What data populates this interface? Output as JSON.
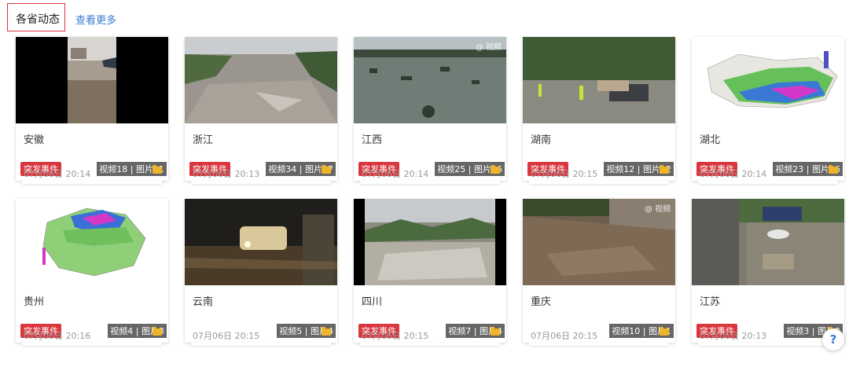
{
  "header": {
    "title": "各省动态",
    "more_link": "查看更多"
  },
  "help_label": "?",
  "cards": [
    {
      "name": "安徽",
      "counts": "视频18 | 图片11",
      "tag": "突发事件",
      "time": "07月06日 20:14",
      "watermark": ""
    },
    {
      "name": "浙江",
      "counts": "视频34 | 图片37",
      "tag": "突发事件",
      "time": "07月06日 20:13",
      "watermark": ""
    },
    {
      "name": "江西",
      "counts": "视频25 | 图片96",
      "tag": "突发事件",
      "time": "07月06日 20:14",
      "watermark": "@ 视频"
    },
    {
      "name": "湖南",
      "counts": "视频12 | 图片12",
      "tag": "突发事件",
      "time": "07月06日 20:15",
      "watermark": ""
    },
    {
      "name": "湖北",
      "counts": "视频23 | 图片16",
      "tag": "突发事件",
      "time": "07月06日 20:14",
      "watermark": ""
    },
    {
      "name": "贵州",
      "counts": "视频4 | 图片3",
      "tag": "突发事件",
      "time": "07月06日 20:16",
      "watermark": ""
    },
    {
      "name": "云南",
      "counts": "视频5 | 图片4",
      "tag": "",
      "time": "07月06日 20:15",
      "watermark": ""
    },
    {
      "name": "四川",
      "counts": "视频7 | 图片4",
      "tag": "突发事件",
      "time": "07月06日 20:15",
      "watermark": ""
    },
    {
      "name": "重庆",
      "counts": "视频10 | 图片1",
      "tag": "",
      "time": "07月06日 20:15",
      "watermark": "@ 视频"
    },
    {
      "name": "江苏",
      "counts": "视频3 | 图片2",
      "tag": "突发事件",
      "time": "07月06日 20:13",
      "watermark": ""
    }
  ]
}
